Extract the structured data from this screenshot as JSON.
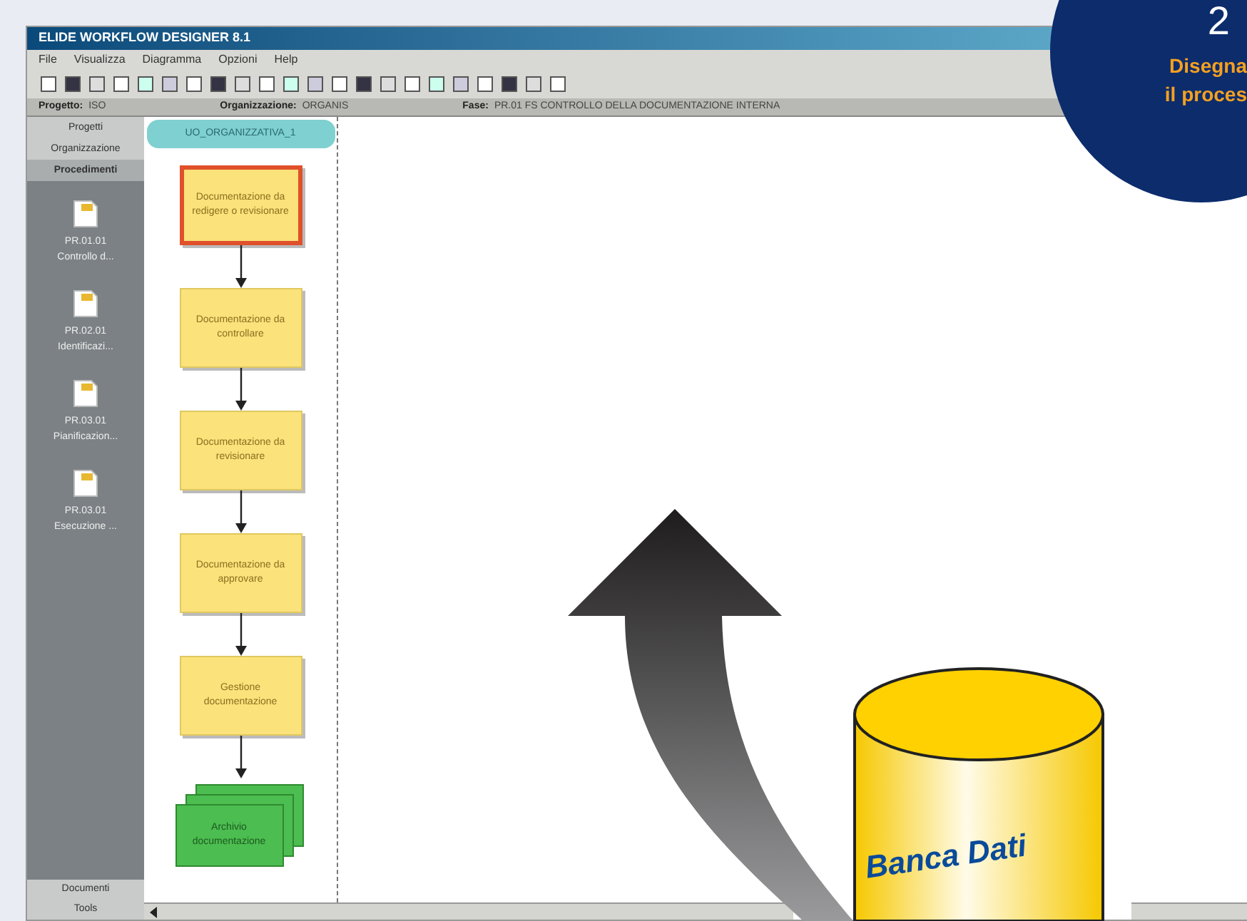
{
  "window": {
    "title": "ELIDE WORKFLOW DESIGNER 8.1"
  },
  "menu": [
    "File",
    "Visualizza",
    "Diagramma",
    "Opzioni",
    "Help"
  ],
  "info_bar": [
    {
      "label": "Progetto:",
      "value": "ISO"
    },
    {
      "label": "Organizzazione:",
      "value": "ORGANIS"
    },
    {
      "label": "Fase:",
      "value": "PR.01 FS CONTROLLO DELLA DOCUMENTAZIONE INTERNA"
    }
  ],
  "sidebar": {
    "top_tabs": [
      {
        "label": "Progetti",
        "selected": false
      },
      {
        "label": "Organizzazione",
        "selected": false
      },
      {
        "label": "Procedimenti",
        "selected": true
      }
    ],
    "items": [
      {
        "code": "PR.01.01",
        "name": "Controllo d..."
      },
      {
        "code": "PR.02.01",
        "name": "Identificazi..."
      },
      {
        "code": "PR.03.01",
        "name": "Pianificazion..."
      },
      {
        "code": "PR.03.01",
        "name": "Esecuzione ..."
      }
    ],
    "bottom_tabs": [
      {
        "label": "Documenti",
        "selected": false
      },
      {
        "label": "Tools",
        "selected": false
      }
    ]
  },
  "lane": {
    "title": "UO_ORGANIZZATIVA_1",
    "steps": [
      {
        "kind": "activity",
        "label": "Documentazione da redigere o revisionare",
        "selected": true
      },
      {
        "kind": "activity",
        "label": "Documentazione da controllare",
        "selected": false
      },
      {
        "kind": "activity",
        "label": "Documentazione da revisionare",
        "selected": false
      },
      {
        "kind": "activity",
        "label": "Documentazione da approvare",
        "selected": false
      },
      {
        "kind": "activity",
        "label": "Gestione documentazione",
        "selected": false
      },
      {
        "kind": "document",
        "label": "Archivio documentazione",
        "selected": false
      }
    ]
  },
  "badge": {
    "number": "2",
    "caption": "Disegna il proces"
  },
  "database": {
    "label": "Banca Dati"
  }
}
